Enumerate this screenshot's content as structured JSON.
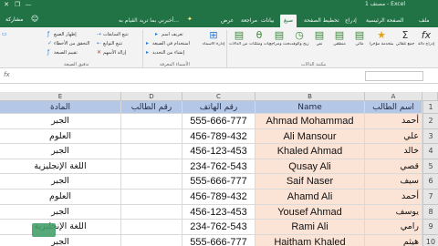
{
  "titlebar": {
    "title": "مصنف 1 - Excel",
    "minimize": "—",
    "restore": "❐",
    "close": "✕"
  },
  "ribbon": {
    "tabs": [
      "ملف",
      "الصفحة الرئيسية",
      "إدراج",
      "تخطيط الصفحة",
      "صيغ",
      "بيانات",
      "مراجعة",
      "عرض"
    ],
    "active_tab": "صيغ",
    "tellme": "أخبرني بما تريد القيام به...",
    "share": "مشاركة",
    "groups": {
      "function_library": {
        "label": "مكتبة الدالات",
        "buttons": [
          "إدراج دالة",
          "جمع تلقائي",
          "المستخدمة مؤخراً",
          "مالي",
          "منطقي",
          "نص",
          "التاريخ والوقت",
          "بحث ومراجع",
          "رياضيات ومثلثات",
          "المزيد من الدالات"
        ]
      },
      "defined_names": {
        "label": "الأسماء المعرفة",
        "manager": "إدارة الأسماء",
        "items": [
          "تعريف اسم",
          "استخدام في الصيغة",
          "إنشاء من التحديد"
        ]
      },
      "formula_auditing": {
        "label": "تدقيق الصيغة",
        "items": [
          "تتبع السابقات",
          "تتبع التوابع",
          "إزالة الأسهم"
        ],
        "side_items": [
          "إظهار الصيغ",
          "التحقق من الأخطاء",
          "تقييم الصيغة"
        ]
      }
    }
  },
  "formula_bar": {
    "fx": "fx",
    "value": "",
    "name_box": ""
  },
  "sheet": {
    "columns": [
      "A",
      "B",
      "C",
      "D",
      "E"
    ],
    "row_numbers": [
      "1",
      "2",
      "3",
      "4",
      "5",
      "6",
      "7",
      "8",
      "9",
      "10"
    ],
    "header": [
      "اسم الطالب",
      "Name",
      "رقم الهاتف",
      "رقم الطالب",
      "المادة"
    ],
    "rows": [
      [
        "أحمد",
        "Ahmad Mohammad",
        "555-666-777",
        "",
        "الجبر"
      ],
      [
        "علي",
        "Ali Mansour",
        "456-789-432",
        "",
        "العلوم"
      ],
      [
        "خالد",
        "Khaled Ahmad",
        "456-123-453",
        "",
        "الجبر"
      ],
      [
        "قصي",
        "Qusay Ali",
        "234-762-543",
        "",
        "اللغة الإنجليزية"
      ],
      [
        "سيف",
        "Saif Naser",
        "555-666-777",
        "",
        "الجبر"
      ],
      [
        "أحمد",
        "Ahamd Ali",
        "456-789-432",
        "",
        "العلوم"
      ],
      [
        "يوسف",
        "Yousef Ahmad",
        "456-123-453",
        "",
        "الجبر"
      ],
      [
        "رامي",
        "Rami Ali",
        "234-762-543",
        "",
        "اللغة الإنجليزية"
      ],
      [
        "هيثم",
        "Haitham Khaled",
        "555-666-777",
        "",
        "الجبر"
      ]
    ]
  },
  "colors": {
    "excel_green": "#217346",
    "header_blue": "#b4c7e7",
    "name_peach": "#fbe3d6"
  }
}
